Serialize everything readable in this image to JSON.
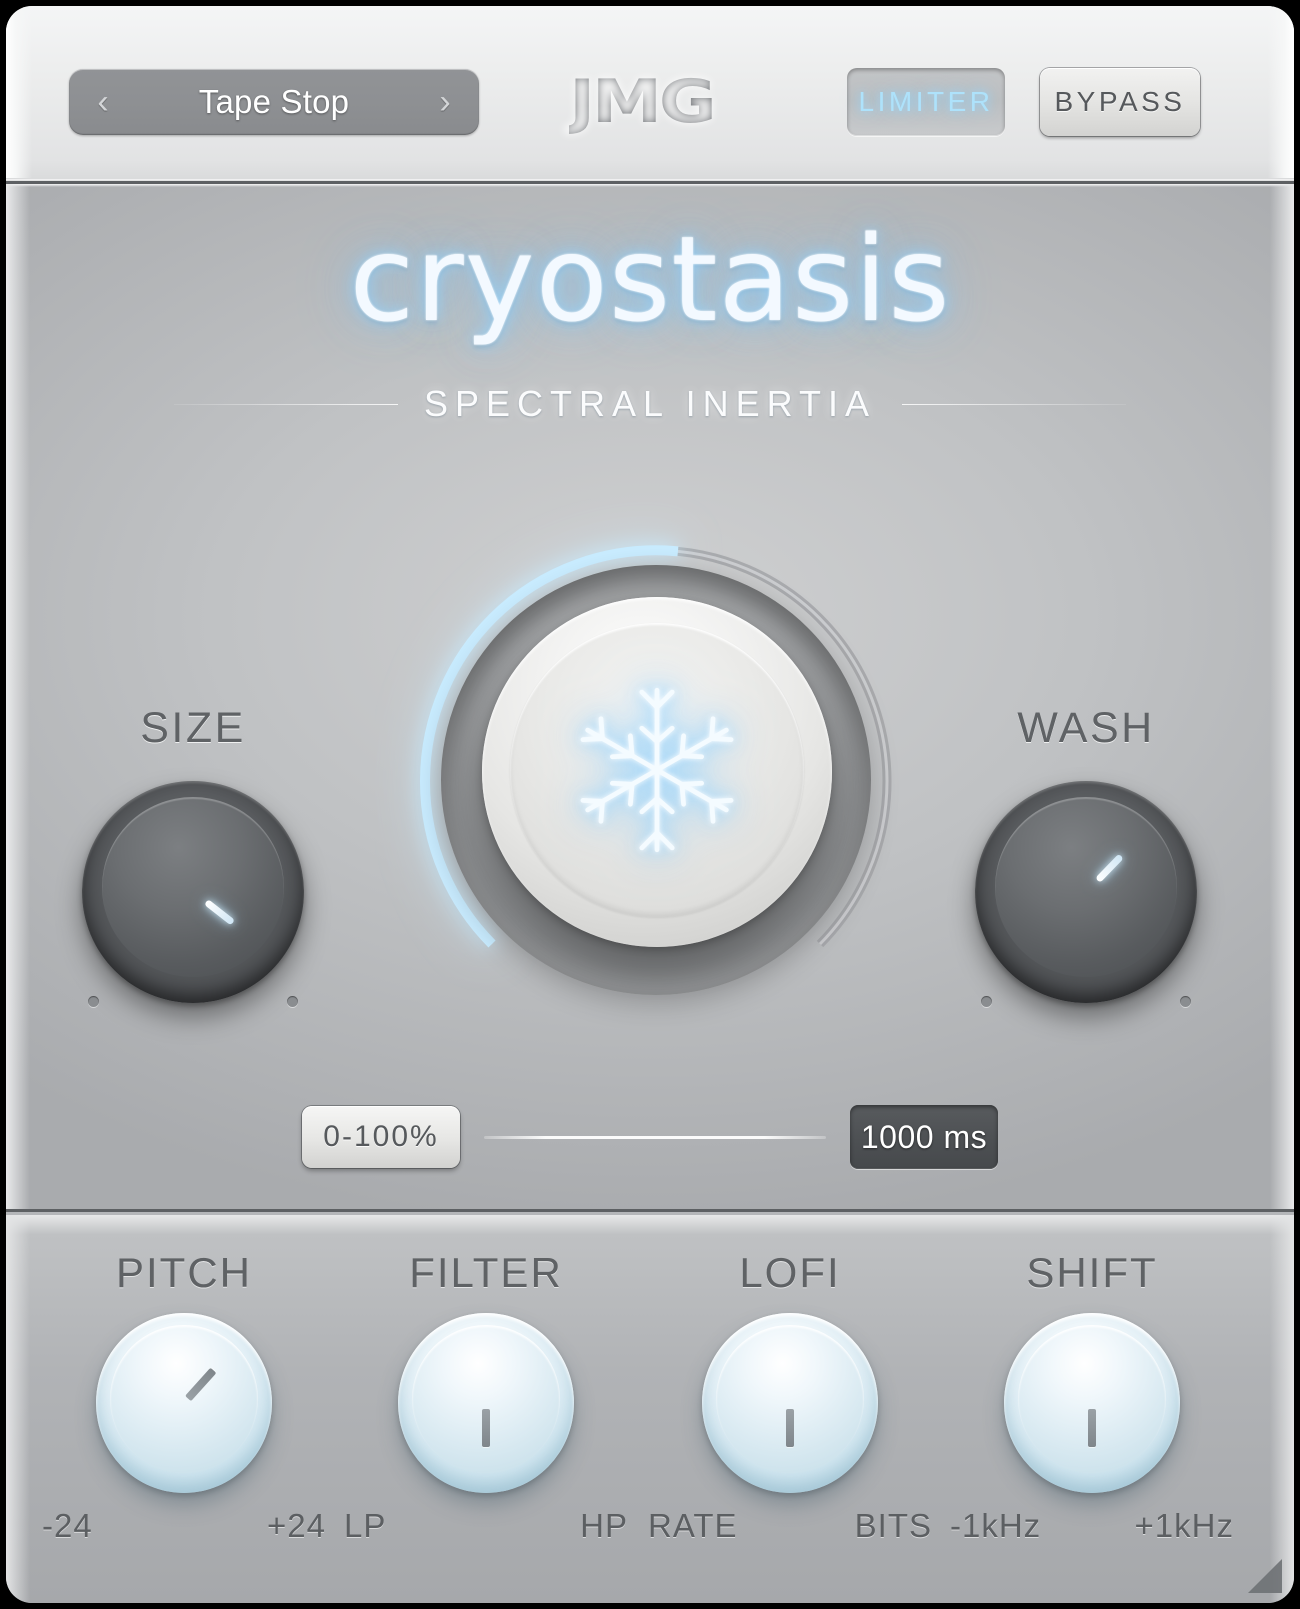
{
  "header": {
    "preset": {
      "name": "Tape Stop",
      "prev_icon": "chevron-left-icon",
      "next_icon": "chevron-right-icon"
    },
    "brand": "JMG",
    "limiter_label": "LIMITER",
    "limiter_active": true,
    "bypass_label": "BYPASS",
    "bypass_active": false
  },
  "main": {
    "title": "cryostasis",
    "subtitle": "SPECTRAL INERTIA",
    "freeze_knob": {
      "icon": "snowflake-icon",
      "arc_value_pct": 52
    },
    "size_knob": {
      "label": "SIZE",
      "angle_deg": -52
    },
    "wash_knob": {
      "label": "WASH",
      "angle_deg": -136
    },
    "range_button": "0-100%",
    "time_readout": "1000 ms"
  },
  "bottom": {
    "knobs": [
      {
        "label": "PITCH",
        "min_label": "-24",
        "max_label": "+24",
        "angle_deg": -138
      },
      {
        "label": "FILTER",
        "min_label": "LP",
        "max_label": "HP",
        "angle_deg": 0
      },
      {
        "label": "LOFI",
        "min_label": "RATE",
        "max_label": "BITS",
        "angle_deg": 0
      },
      {
        "label": "SHIFT",
        "min_label": "-1kHz",
        "max_label": "+1kHz",
        "angle_deg": 0
      }
    ]
  },
  "colors": {
    "accent_glow": "#a8dcfb",
    "panel_light": "#eceded",
    "panel_mid": "#c0c2c4",
    "panel_bottom": "#b1b3b6",
    "dark_knob": "#5f6265",
    "light_knob": "#dceef5",
    "text_dark": "#5f6265"
  }
}
